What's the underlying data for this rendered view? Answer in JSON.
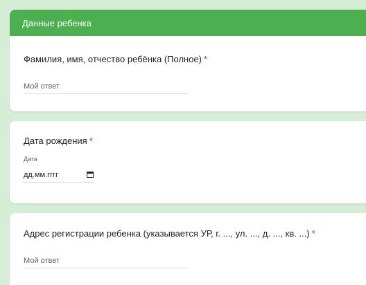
{
  "form": {
    "section_title": "Данные ребенка",
    "questions": [
      {
        "label": "Фамилия, имя, отчество ребёнка (Полное)",
        "required_mark": "*",
        "placeholder": "Мой ответ"
      },
      {
        "label": "Дата рождения",
        "required_mark": "*",
        "sub_label": "Дата",
        "value_placeholder": "дд.мм.гггг",
        "icon": "calendar-icon"
      },
      {
        "label": "Адрес регистрации ребенка (указывается УР, г. ..., ул. ..., д. ..., кв. ...)",
        "required_mark": "*",
        "placeholder": "Мой ответ"
      }
    ]
  },
  "colors": {
    "header_bg": "#4caf50",
    "page_bg": "#d5eed5",
    "required": "#d93025"
  }
}
